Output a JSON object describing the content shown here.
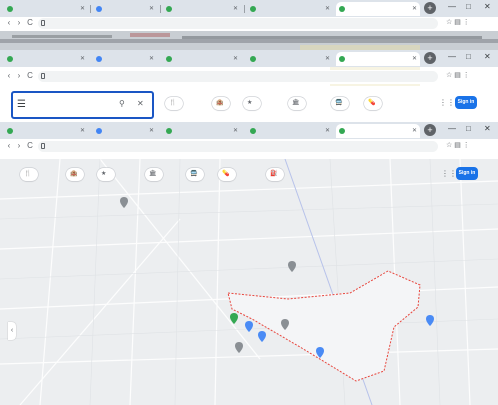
{
  "window": {
    "tab_strip_1": [
      {
        "label": "",
        "active": false,
        "fav": "green"
      },
      {
        "label": "",
        "active": false,
        "fav": "blue"
      },
      {
        "label": "",
        "active": false,
        "fav": "green"
      },
      {
        "label": "",
        "active": false,
        "fav": "green"
      },
      {
        "label": "",
        "active": true,
        "fav": "green"
      }
    ],
    "tab_strip_2": [
      {
        "label": "",
        "active": false,
        "fav": "green"
      },
      {
        "label": "",
        "active": false,
        "fav": "blue"
      },
      {
        "label": "",
        "active": false,
        "fav": "green"
      },
      {
        "label": "",
        "active": false,
        "fav": "green"
      },
      {
        "label": "",
        "active": true,
        "fav": "green"
      }
    ],
    "tab_strip_3": [
      {
        "label": "",
        "active": false,
        "fav": "green"
      },
      {
        "label": "",
        "active": false,
        "fav": "blue"
      },
      {
        "label": "",
        "active": false,
        "fav": "green"
      },
      {
        "label": "",
        "active": false,
        "fav": "green"
      },
      {
        "label": "",
        "active": true,
        "fav": "green"
      }
    ],
    "new_tab": "+",
    "controls": {
      "minimize": "—",
      "maximize": "□",
      "close": "✕"
    }
  },
  "address_bars": [
    {
      "url": "",
      "nav": [
        "‹",
        "›",
        "C"
      ],
      "tail": "☆ ▤ ⋮"
    },
    {
      "url": "",
      "nav": [
        "‹",
        "›",
        "C"
      ],
      "tail": "☆ ▤ ⋮"
    },
    {
      "url": "",
      "nav": [
        "‹",
        "›",
        "C"
      ],
      "tail": "☆ ▤ ⋮"
    }
  ],
  "maps": {
    "search": {
      "menu_icon": "☰",
      "query": "",
      "search_icon": "⚲",
      "clear_icon": "✕"
    },
    "chips_top": [
      {
        "label": "",
        "icon": "🍴"
      },
      {
        "label": "",
        "icon": "🏨"
      },
      {
        "label": "",
        "icon": "★"
      },
      {
        "label": "",
        "icon": "🏛"
      },
      {
        "label": "",
        "icon": "🚍"
      },
      {
        "label": "",
        "icon": "💊"
      }
    ],
    "chips_bottom": [
      {
        "label": "",
        "icon": "🍴"
      },
      {
        "label": "",
        "icon": "🏨"
      },
      {
        "label": "",
        "icon": "★"
      },
      {
        "label": "",
        "icon": "🏛"
      },
      {
        "label": "",
        "icon": "🚍"
      },
      {
        "label": "",
        "icon": "💊"
      },
      {
        "label": "",
        "icon": "⛽"
      }
    ],
    "apps_icon": "⋮⋮",
    "sign_in": "Sign in",
    "collapse_icon": "‹",
    "place_labels": [
      "",
      "",
      "",
      "",
      "",
      "",
      "",
      "",
      "",
      ""
    ],
    "road_labels": [
      "",
      "",
      ""
    ],
    "colors": {
      "area_outline": "#e8453c",
      "pin_blue": "#4a8bf5",
      "pin_green": "#34a853",
      "pin_grey": "#8a8f94",
      "chip_accent": "#1a73e8"
    }
  }
}
